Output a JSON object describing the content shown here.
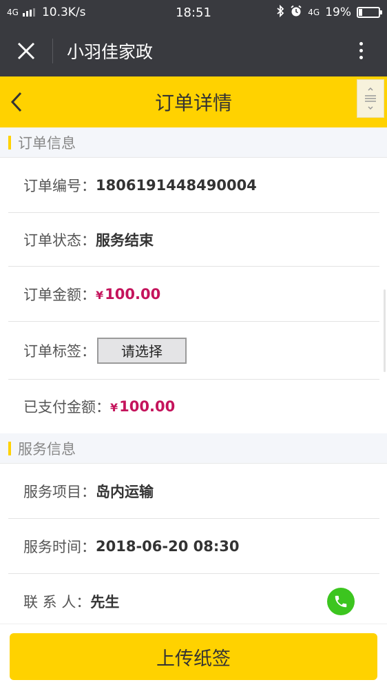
{
  "status_bar": {
    "network_type": "4G",
    "speed": "10.3K/s",
    "time": "18:51",
    "network_type_2": "4G",
    "battery_percent": "19%",
    "battery_level": 0.19
  },
  "wechat_bar": {
    "title": "小羽佳家政"
  },
  "header": {
    "title": "订单详情"
  },
  "order_section": {
    "title": "订单信息",
    "rows": [
      {
        "label": "订单编号：",
        "value": "1806191448490004"
      },
      {
        "label": "订单状态：",
        "value": "服务结束"
      },
      {
        "label": "订单金额：",
        "currency": "¥",
        "amount": "100.00"
      },
      {
        "label": "订单标签：",
        "select_value": "请选择"
      },
      {
        "label": "已支付金额：",
        "currency": "¥",
        "amount": "100.00"
      }
    ]
  },
  "service_section": {
    "title": "服务信息",
    "rows": [
      {
        "label": "服务项目：",
        "value": "岛内运输"
      },
      {
        "label": "服务时间：",
        "value": "2018-06-20 08:30"
      },
      {
        "label": "联 系 人：",
        "value": "先生"
      }
    ]
  },
  "footer": {
    "upload_label": "上传纸签"
  },
  "colors": {
    "accent": "#ffd200",
    "money": "#c4145c",
    "phone": "#3cc51f",
    "dark_bar": "#393a3f"
  }
}
